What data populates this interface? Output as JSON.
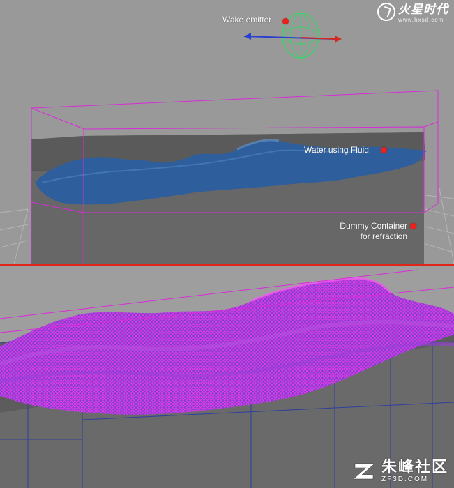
{
  "top_view": {
    "annotations": [
      {
        "id": "wake-emitter",
        "lines": [
          "Wake emitter"
        ]
      },
      {
        "id": "water-fluid",
        "lines": [
          "Water using Fluid"
        ]
      },
      {
        "id": "dummy-container",
        "lines": [
          "Dummy Container",
          "for refraction"
        ]
      }
    ]
  },
  "logo": {
    "main": "火星时代",
    "sub": "www.hxsd.com"
  },
  "watermark": {
    "main": "朱峰社区",
    "sub": "ZF3D.COM"
  },
  "colors": {
    "accent": "#e8231b",
    "divider": "#e0251b",
    "wireframe": "#d92ad9",
    "water": "#2e5f9c"
  }
}
